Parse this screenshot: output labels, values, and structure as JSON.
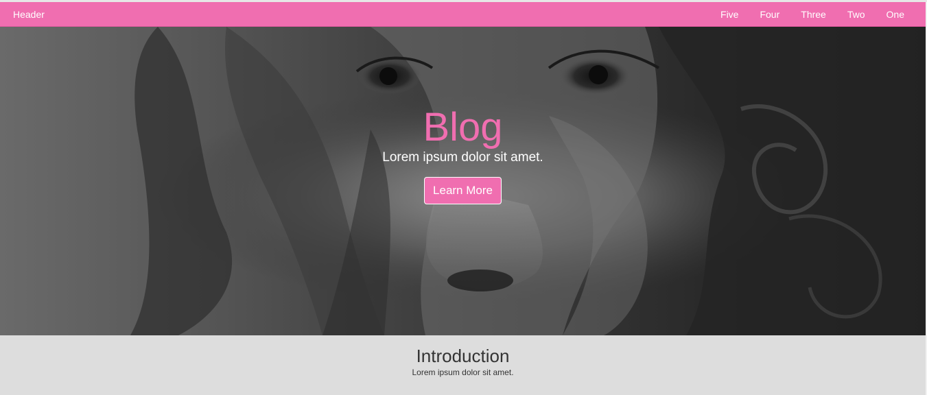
{
  "navbar": {
    "brand": "Header",
    "links": [
      "Five",
      "Four",
      "Three",
      "Two",
      "One"
    ],
    "color": "#f06eb0"
  },
  "hero": {
    "title": "Blog",
    "subtitle": "Lorem ipsum dolor sit amet.",
    "button_label": "Learn More",
    "accent_color": "#f06eb0"
  },
  "intro": {
    "title": "Introduction",
    "text": "Lorem ipsum dolor sit amet.",
    "background": "#dddddd"
  }
}
